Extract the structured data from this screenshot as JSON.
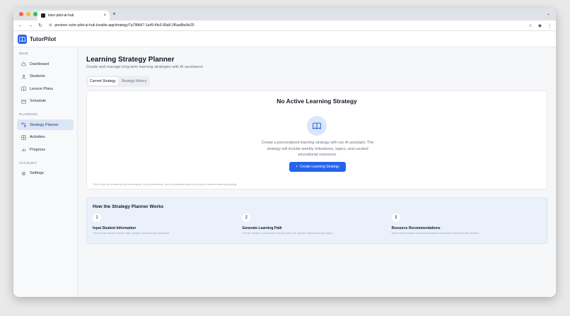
{
  "browser": {
    "tab_title": "tutor-pilot-ai-hub",
    "url": "preview--tutor-pilot-ai-hub.lovable.app/strategy/7a798b67-1a49-4fe3-96a8-2f6ae8bc8e20",
    "traffic_colors": [
      "#fe5f57",
      "#febc2e",
      "#28c840"
    ]
  },
  "app": {
    "brand": "TutorPilot",
    "accent_color": "#2563eb"
  },
  "sidebar": {
    "main_label": "MAIN",
    "main_items": [
      {
        "label": "Dashboard",
        "icon": "home-icon"
      },
      {
        "label": "Students",
        "icon": "user-icon"
      },
      {
        "label": "Lesson Plans",
        "icon": "book-icon"
      },
      {
        "label": "Schedule",
        "icon": "calendar-icon"
      }
    ],
    "planning_label": "PLANNING",
    "planning_items": [
      {
        "label": "Strategy Planner",
        "icon": "strategy-icon",
        "active": true
      },
      {
        "label": "Activities",
        "icon": "grid-icon"
      },
      {
        "label": "Progress",
        "icon": "bar-chart-icon"
      }
    ],
    "account_label": "ACCOUNT",
    "account_items": [
      {
        "label": "Settings",
        "icon": "gear-icon"
      }
    ]
  },
  "main": {
    "title": "Learning Strategy Planner",
    "subtitle": "Create and manage long-term learning strategies with AI assistance",
    "tabs": [
      {
        "label": "Current Strategy",
        "active": true
      },
      {
        "label": "Strategy History",
        "active": false
      }
    ],
    "empty_card": {
      "title": "No Active Learning Strategy",
      "description": "Create a personalized learning strategy with our AI assistant. The strategy will include weekly milestones, topics, and curated educational resources.",
      "button_label": "Create Learning Strategy",
      "footer": "The AI will use student profile information, tutor preferences, and educational system to create a tailored learning strategy."
    },
    "how": {
      "title": "How the Strategy Planner Works",
      "steps": [
        {
          "number": "1",
          "title": "Input Student Information",
          "description": "The AI uses student profile data, subject, and learning objectives"
        },
        {
          "number": "2",
          "title": "Generate Learning Path",
          "description": "The AI creates a customized weekly plan with specific milestones and topics"
        },
        {
          "number": "3",
          "title": "Resource Recommendations",
          "description": "Each week includes curated educational resources tailored to the student"
        }
      ]
    }
  }
}
